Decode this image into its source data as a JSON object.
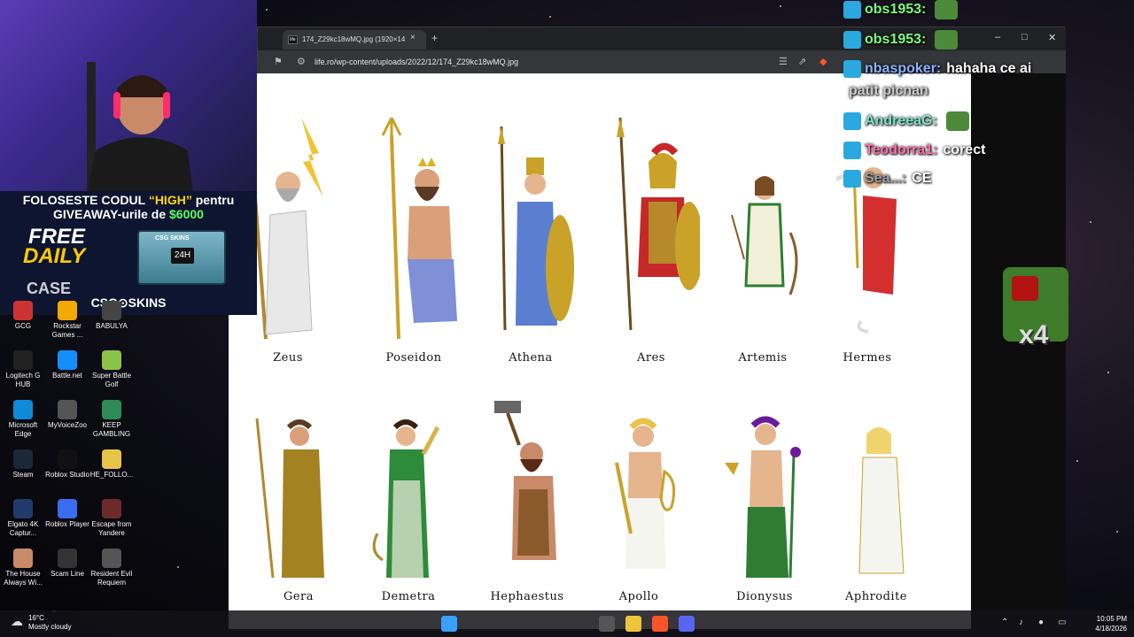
{
  "browser": {
    "tab_title": "174_Z29kc18wMQ.jpg (1920×14",
    "favicon_text": "life",
    "url": "life.ro/wp-content/uploads/2022/12/174_Z29kc18wMQ.jpg",
    "new_tab": "+",
    "tab_close": "×",
    "minimize": "–",
    "maximize": "□",
    "close": "✕"
  },
  "gods_row1": [
    "Zeus",
    "Poseidon",
    "Athena",
    "Ares",
    "Artemis",
    "Hermes"
  ],
  "gods_row2": [
    "Gera",
    "Demetra",
    "Hephaestus",
    "Apollo",
    "Dionysus",
    "Aphrodite"
  ],
  "promo": {
    "line1_a": "FOLOSESTE CODUL ",
    "line1_code": "“HIGH”",
    "line1_b": " pentru",
    "line2_a": "GIVEAWAY-urile de ",
    "line2_amount": "$6000",
    "free": "FREE",
    "daily": "DAILY",
    "case": "CASE",
    "box_text": "24H",
    "box_brand": "CSG SKINS",
    "brand": "CSG⊙SKINS"
  },
  "chat": [
    {
      "user": "obs1953:",
      "text": "",
      "color": "#7dff7d"
    },
    {
      "user": "obs1953:",
      "text": "",
      "color": "#7dff7d"
    },
    {
      "user": "nbaspoker:",
      "text": "hahaha ce ai",
      "color": "#8ab4ff"
    },
    {
      "user": "",
      "text": "patit picnan",
      "color": "#cccccc"
    },
    {
      "user": "AndreeaG:",
      "text": "",
      "color": "#7de3c8"
    },
    {
      "user": "Teodorra1:",
      "text": "corect",
      "color": "#ff6fa8"
    },
    {
      "user": "Sea...:",
      "text": "CE",
      "color": "#9aa0a6"
    }
  ],
  "emote_multiplier": "x4",
  "desktop_icons": [
    {
      "label": "GCG",
      "color": "#cc3333"
    },
    {
      "label": "Rockstar Games ...",
      "color": "#f2a900"
    },
    {
      "label": "BABULYA",
      "color": "#444444"
    },
    {
      "label": "Logitech G HUB",
      "color": "#222222"
    },
    {
      "label": "Battle.net",
      "color": "#148eff"
    },
    {
      "label": "Super Battle Golf",
      "color": "#8bc34a"
    },
    {
      "label": "Microsoft Edge",
      "color": "#0f8ad9"
    },
    {
      "label": "MyVoiceZoo",
      "color": "#555555"
    },
    {
      "label": "KEEP GAMBLING",
      "color": "#2e8b57"
    },
    {
      "label": "Steam",
      "color": "#1b2838"
    },
    {
      "label": "Roblox Studio",
      "color": "#111111"
    },
    {
      "label": "HE_FOLLO...",
      "color": "#e8c34a"
    },
    {
      "label": "Elgato 4K Captur...",
      "color": "#203a6b"
    },
    {
      "label": "Roblox Player",
      "color": "#3a6cf0"
    },
    {
      "label": "Escape from Yandere",
      "color": "#6b2b2b"
    },
    {
      "label": "The House Always Wi...",
      "color": "#c98a6a"
    },
    {
      "label": "Scam Line",
      "color": "#333333"
    },
    {
      "label": "Resident Evil Requiem",
      "color": "#555555"
    }
  ],
  "taskbar": {
    "temp": "16°C",
    "condition": "Mostly cloudy",
    "time": "10:05 PM",
    "date": "4/18/2026"
  }
}
